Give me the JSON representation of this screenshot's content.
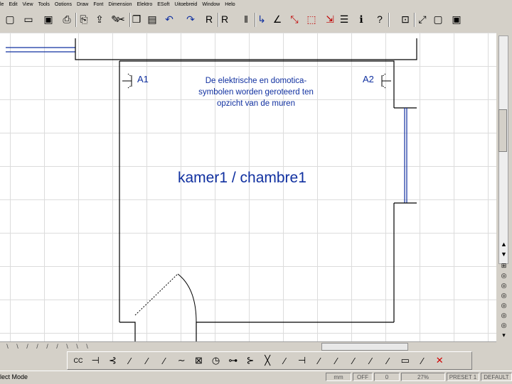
{
  "menu": [
    "le",
    "Edit",
    "View",
    "Tools",
    "Options",
    "Draw",
    "Font",
    "Dimension",
    "Elektro",
    "ESoft",
    "Uitgebreid",
    "Window",
    "Help"
  ],
  "toolbar": {
    "icons": [
      "new-icon",
      "open-icon",
      "save-icon",
      "print-icon",
      "print-preview-icon",
      "export-icon",
      "draw-icon",
      "cut-icon",
      "copy-icon",
      "paste-icon",
      "undo-icon",
      "redo-icon",
      "insert-r-icon",
      "insert-r2-icon",
      "parallel-lines-icon",
      "route-icon",
      "angle-icon",
      "snap-icon",
      "select-box-icon",
      "stretch-icon",
      "layer-icon",
      "info-icon",
      "help-arrow-icon",
      "zoom-fit-icon",
      "zoom-window-icon",
      "window-icon",
      "maximize-icon"
    ]
  },
  "canvas": {
    "room_name": "kamer1 / chambre1",
    "note": [
      "De elektrische en domotica-",
      "symbolen worden geroteerd ten",
      "opzicht van de muren"
    ],
    "symbols": {
      "a1": "A1",
      "a2": "A2"
    },
    "line_color": "#000000",
    "text_color": "#1030a0"
  },
  "hscroll_ticks": [
    "\\",
    "\\",
    "/",
    "/",
    "/",
    "/",
    "\\",
    "\\",
    "\\"
  ],
  "palette": {
    "icons": [
      "cc-icon",
      "switch1-icon",
      "switch2-icon",
      "switch3-icon",
      "switch4-icon",
      "switch5-icon",
      "line-icon",
      "lamp-box-icon",
      "timer-icon",
      "socket-icon",
      "outlet-icon",
      "cross-switch-icon",
      "switch6-icon",
      "switch7-icon",
      "switch8-icon",
      "switch9-icon",
      "switch10-icon",
      "switch11-icon",
      "switch12-icon",
      "fuse-icon",
      "switch13-icon",
      "close-red-icon"
    ],
    "cc_label": "CC"
  },
  "status": {
    "mode": "lect Mode",
    "unit": "mm",
    "snap": "OFF",
    "angle": "0",
    "zoom": "27%",
    "preset": "PRESET 1",
    "layer": "DEFAULT"
  }
}
